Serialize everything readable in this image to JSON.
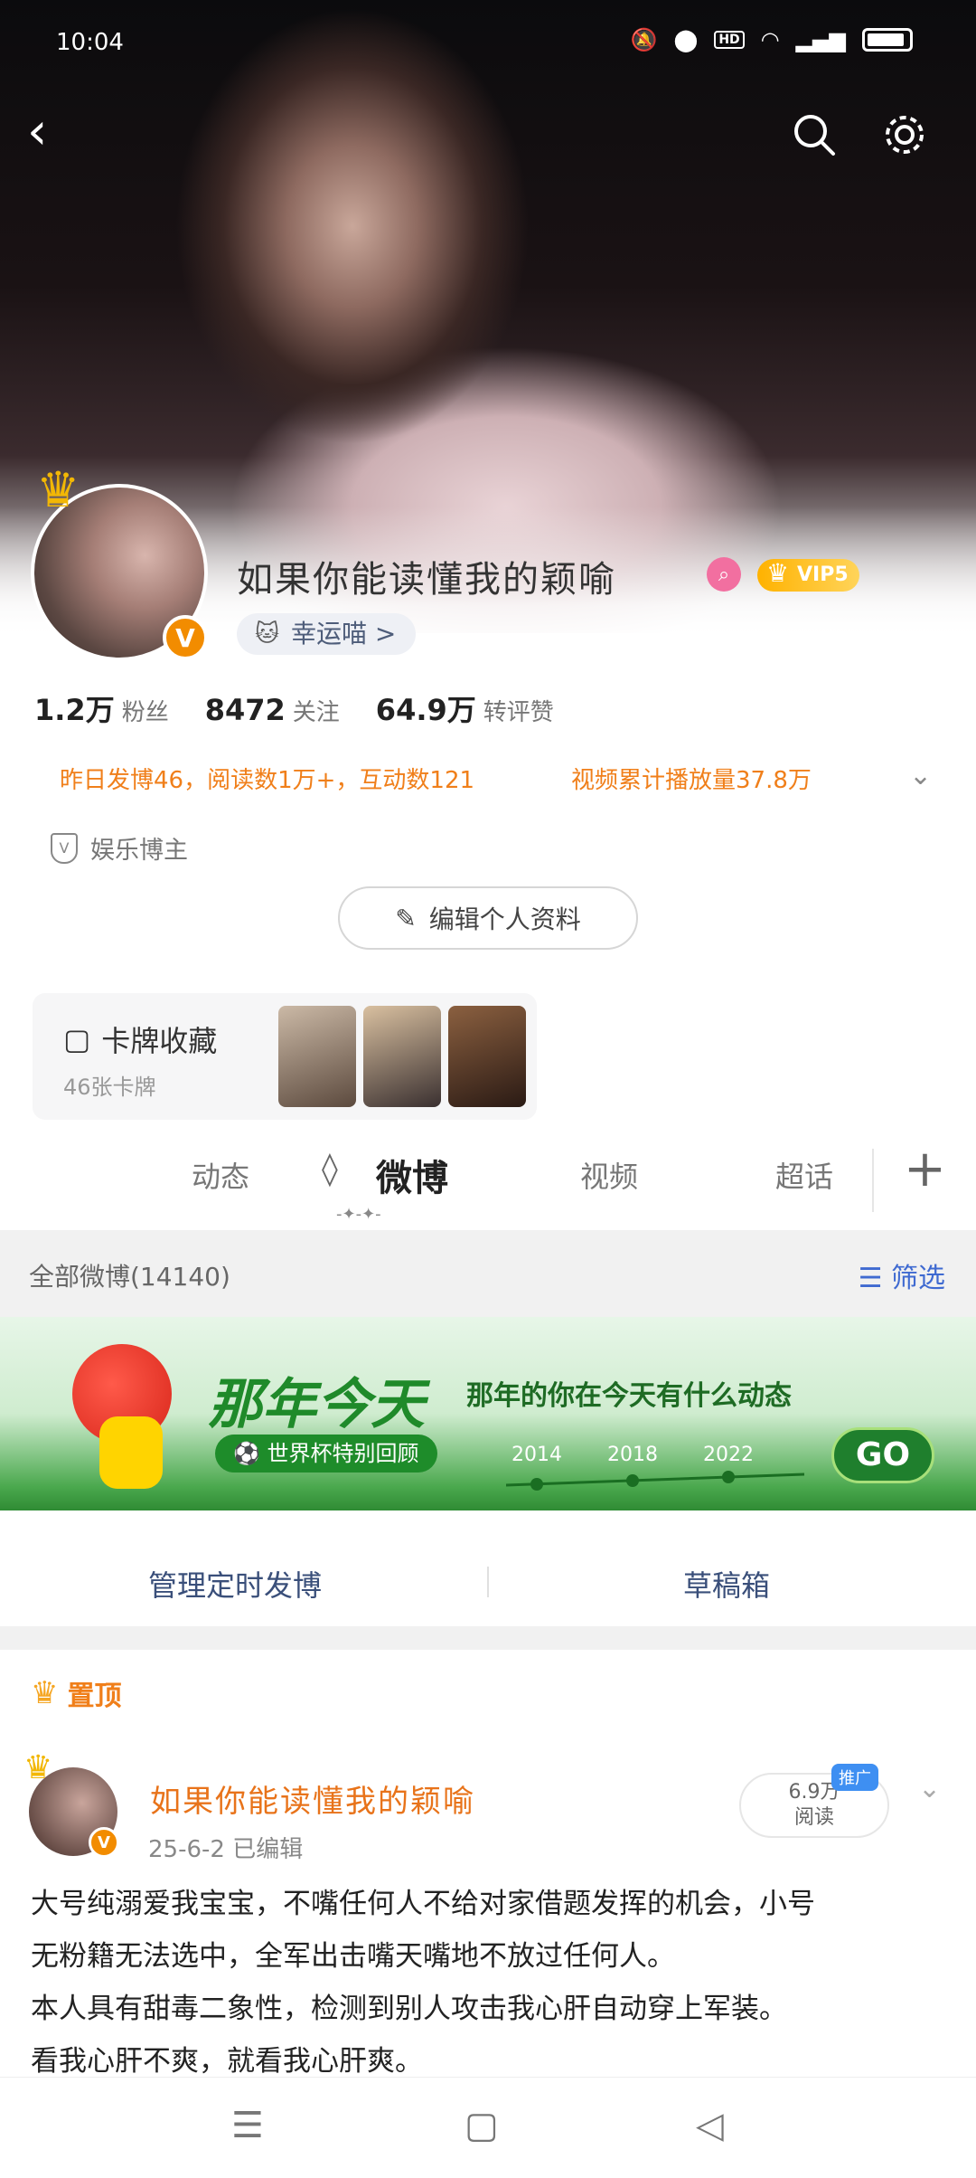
{
  "status_bar": {
    "time": "10:04"
  },
  "header": {
    "back_icon": "back-icon",
    "search_icon": "search-icon",
    "settings_icon": "gear-icon"
  },
  "profile": {
    "nickname": "如果你能读懂我的颖喻",
    "vip": "VIP5",
    "lucky_tag": "幸运喵 >",
    "stats": [
      {
        "num": "1.2万",
        "label": "粉丝"
      },
      {
        "num": "8472",
        "label": "关注"
      },
      {
        "num": "64.9万",
        "label": "转评赞"
      }
    ],
    "summary_left": "昨日发博46，阅读数1万+，互动数121",
    "summary_right": "视频累计播放量37.8万",
    "role_tag": "娱乐博主",
    "edit_button": "编辑个人资料"
  },
  "card_collection": {
    "title": "卡牌收藏",
    "sub": "46张卡牌"
  },
  "tabs": [
    "动态",
    "微博",
    "视频",
    "超话"
  ],
  "all_weibo": {
    "label": "全部微博(14140)",
    "filter": "筛选"
  },
  "banner": {
    "title": "那年今天",
    "subtitle": "那年的你在今天有什么动态",
    "pill": "世界杯特别回顾",
    "years": [
      "2014",
      "2018",
      "2022"
    ],
    "go": "GO"
  },
  "actions": {
    "schedule": "管理定时发博",
    "drafts": "草稿箱"
  },
  "pinned_label": "置顶",
  "post": {
    "author": "如果你能读懂我的颖喻",
    "meta": "25-6-2  已编辑",
    "reads": "6.9万",
    "reads_label": "阅读",
    "promo": "推广",
    "lines": [
      "大号纯溺爱我宝宝，不嘴任何人不给对家借题发挥的机会，小号",
      "无粉籍无法选中，全军出击嘴天嘴地不放过任何人。",
      "本人具有甜毒二象性，检测到别人攻击我心肝自动穿上军装。",
      "看我心肝不爽，就看我心肝爽。"
    ]
  },
  "colors": {
    "accent": "#f07f1a",
    "link_blue": "#3f6ad1",
    "vip_gold": "#ffb200"
  }
}
